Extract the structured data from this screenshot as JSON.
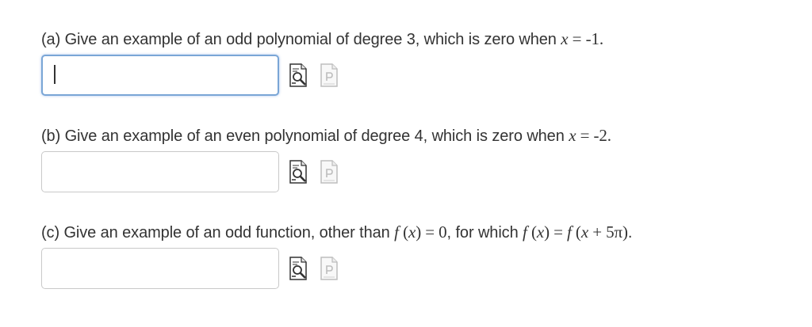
{
  "problems": [
    {
      "id": "a",
      "prefix": "(a) Give an example of an odd polynomial of degree 3, which is zero when ",
      "math_var": "x",
      "math_rest": " = -1.",
      "input_value": "",
      "focused": true
    },
    {
      "id": "b",
      "prefix": "(b) Give an example of an even polynomial of degree 4, which is zero when ",
      "math_var": "x",
      "math_rest": " = -2.",
      "input_value": "",
      "focused": false
    },
    {
      "id": "c",
      "prefix": "(c) Give an example of an odd function, other than ",
      "math1_f": "f",
      "math1_mid": " (",
      "math1_x": "x",
      "math1_end": ") = 0",
      "middle": ", for which ",
      "math2_f1": "f",
      "math2_a": " (",
      "math2_x1": "x",
      "math2_b": ") = ",
      "math2_f2": "f",
      "math2_c": " (",
      "math2_x2": "x",
      "math2_d": " + 5π)",
      "suffix": ".",
      "input_value": "",
      "focused": false
    }
  ],
  "icons": {
    "preview": "preview-magnifier-icon",
    "palette": "equation-palette-icon"
  },
  "colors": {
    "text": "#333333",
    "input_border": "#c9c9c9",
    "focus_border": "#7aa6d6"
  }
}
